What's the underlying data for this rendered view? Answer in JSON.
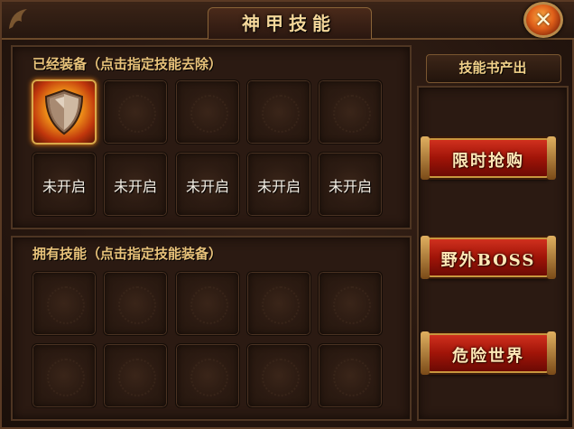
{
  "window": {
    "title": "神甲技能",
    "close_icon": "close-x-icon"
  },
  "equipped": {
    "label": "已经装备（点击指定技能去除）",
    "slots": [
      {
        "state": "equipped",
        "icon": "shield-skill-icon"
      },
      {
        "state": "empty"
      },
      {
        "state": "empty"
      },
      {
        "state": "empty"
      },
      {
        "state": "empty"
      },
      {
        "state": "locked",
        "text": "未开启"
      },
      {
        "state": "locked",
        "text": "未开启"
      },
      {
        "state": "locked",
        "text": "未开启"
      },
      {
        "state": "locked",
        "text": "未开启"
      },
      {
        "state": "locked",
        "text": "未开启"
      }
    ]
  },
  "owned": {
    "label": "拥有技能（点击指定技能装备）",
    "slot_count": 10
  },
  "side": {
    "header": "技能书产出",
    "buttons": [
      {
        "label": "限时抢购"
      },
      {
        "label": "野外BOSS"
      },
      {
        "label": "危险世界"
      }
    ]
  },
  "colors": {
    "accent_gold": "#e8c27a",
    "button_red": "#a01408",
    "frame_brown": "#2b1a12"
  }
}
